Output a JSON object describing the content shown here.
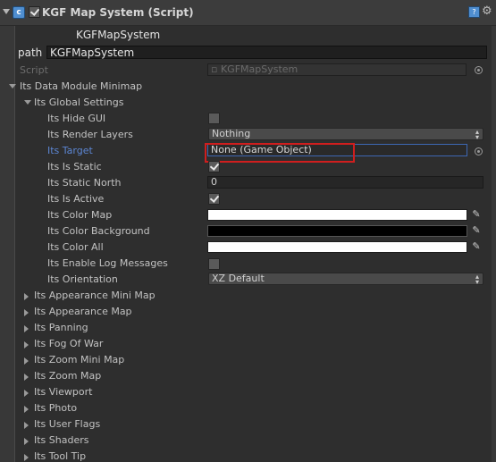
{
  "header": {
    "title": "KGF Map System (Script)",
    "enabled": true,
    "icons": [
      "foldout-icon",
      "script-icon",
      "help-icon",
      "gear-icon"
    ]
  },
  "component": {
    "name": "KGFMapSystem",
    "path_label": "path",
    "path_value": "KGFMapSystem"
  },
  "script_row": {
    "label": "Script",
    "value": "KGFMapSystem"
  },
  "data_module": {
    "label": "Its Data Module Minimap"
  },
  "global_settings": {
    "label": "Its Global Settings",
    "rows": {
      "hide_gui": {
        "label": "Its Hide GUI",
        "checked": false
      },
      "render_layers": {
        "label": "Its Render Layers",
        "value": "Nothing"
      },
      "target": {
        "label": "Its Target",
        "value": "None (Game Object)"
      },
      "is_static": {
        "label": "Its Is Static",
        "checked": true
      },
      "static_north": {
        "label": "Its Static North",
        "value": "0"
      },
      "is_active": {
        "label": "Its Is Active",
        "checked": true
      },
      "color_map": {
        "label": "Its Color Map",
        "color": "#ffffff"
      },
      "color_background": {
        "label": "Its Color Background",
        "color": "#000000"
      },
      "color_all": {
        "label": "Its Color All",
        "color": "#ffffff"
      },
      "enable_log": {
        "label": "Its Enable Log Messages",
        "checked": false
      },
      "orientation": {
        "label": "Its Orientation",
        "value": "XZ Default"
      }
    }
  },
  "collapsed_sections": [
    "Its Appearance Mini Map",
    "Its Appearance Map",
    "Its Panning",
    "Its Fog Of War",
    "Its Zoom Mini Map",
    "Its Zoom Map",
    "Its Viewport",
    "Its Photo",
    "Its User Flags",
    "Its Shaders",
    "Its Tool Tip"
  ],
  "colors": {
    "highlight": "#d01e1e",
    "selected_label": "#5c86d3"
  }
}
